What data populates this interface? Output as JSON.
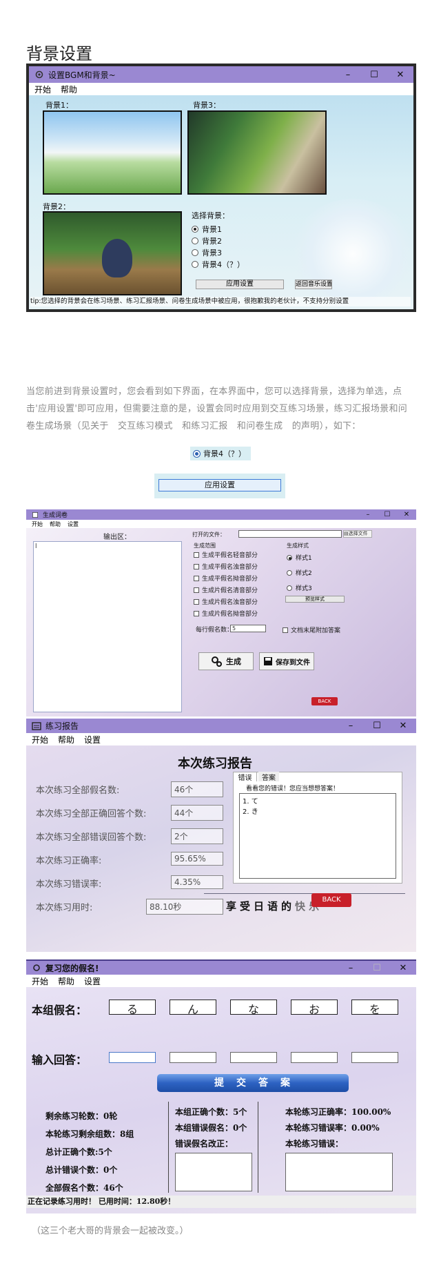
{
  "heading": "背景设置",
  "win1": {
    "title": "设置BGM和背景~",
    "menu": [
      "开始",
      "帮助"
    ],
    "bg1_label": "背景1：",
    "bg3_label": "背景3：",
    "bg2_label": "背景2：",
    "select_label": "选择背景：",
    "options": [
      "背景1",
      "背景2",
      "背景3",
      "背景4（？）"
    ],
    "selected": 0,
    "apply": "应用设置",
    "back_music": "返回音乐设置",
    "tip": "tip:您选择的背景会在练习场景、练习汇报场景、问卷生成场景中被应用，很抱歉我的老伙计，不支持分别设置"
  },
  "paragraph": "当您前进到背景设置时，您会看到如下界面，在本界面中，您可以选择背景，选择为单选，点击'应用设置'即可应用，但需要注意的是，设置会同时应用到交互练习场景，练习汇报场景和问卷生成场景（见关于　交互练习模式　和练习汇报　和问卷生成　的声明），如下：",
  "snip_radio": "背景4（？）",
  "snip_apply": "应用设置",
  "win2": {
    "title": "生成词卷",
    "menu": [
      "开始",
      "帮助",
      "设置"
    ],
    "output_label": "输出区：",
    "output_text": "l",
    "open_file": "打开的文件：",
    "choose_file": "选择文件",
    "range_title": "生成范围",
    "range": [
      "生成平假名轻音部分",
      "生成平假名浊音部分",
      "生成平假名拗音部分",
      "生成片假名清音部分",
      "生成片假名浊音部分",
      "生成片假名拗音部分"
    ],
    "style_title": "生成样式",
    "styles": [
      "样式1",
      "样式2",
      "样式3"
    ],
    "preview": "预览样式",
    "per_line": "每行假名数：",
    "per_line_val": "5",
    "append": "文档末尾附加答案",
    "gen": "生成",
    "save": "保存到文件",
    "back": "BACK"
  },
  "win3": {
    "title": "练习报告",
    "menu": [
      "开始",
      "帮助",
      "设置"
    ],
    "heading": "本次练习报告",
    "rows": [
      {
        "label": "本次练习全部假名数:",
        "val": "46个"
      },
      {
        "label": "本次练习全部正确回答个数:",
        "val": "44个"
      },
      {
        "label": "本次练习全部错误回答个数:",
        "val": "2个"
      },
      {
        "label": "本次练习正确率:",
        "val": "95.65%"
      },
      {
        "label": "本次练习错误率:",
        "val": "4.35%"
      },
      {
        "label": "本次练习用时:",
        "val": "88.10秒"
      }
    ],
    "tabs": [
      "错误",
      "答案"
    ],
    "tab_hint": "看看您的错误！您应当想想答案！",
    "errors": [
      "1. て",
      "2. き"
    ],
    "slogan": "享受日语的",
    "slogan_end": "快乐",
    "back": "BACK"
  },
  "win4": {
    "title": "复习您的假名!",
    "menu": [
      "开始",
      "帮助",
      "设置"
    ],
    "group_label": "本组假名：",
    "kana": [
      "る",
      "ん",
      "な",
      "お",
      "を"
    ],
    "input_label": "输入回答：",
    "submit": "提　交　答　案",
    "left_stats": [
      "剩余练习轮数：0轮",
      "本轮练习剩余组数：8组",
      "总计正确个数:5个",
      "总计错误个数：0个",
      "全部假名个数：46个"
    ],
    "mid_stats": [
      "本组正确个数：5个",
      "本组错误假名：0个",
      "错误假名改正："
    ],
    "right_stats": [
      "本轮练习正确率：100.00%",
      "本轮练习错误率：0.00%",
      "本轮练习错误："
    ],
    "status": "正在记录练习用时！ 已用时间：12.80秒！"
  },
  "caption": "（这三个老大哥的背景会一起被改变。）"
}
